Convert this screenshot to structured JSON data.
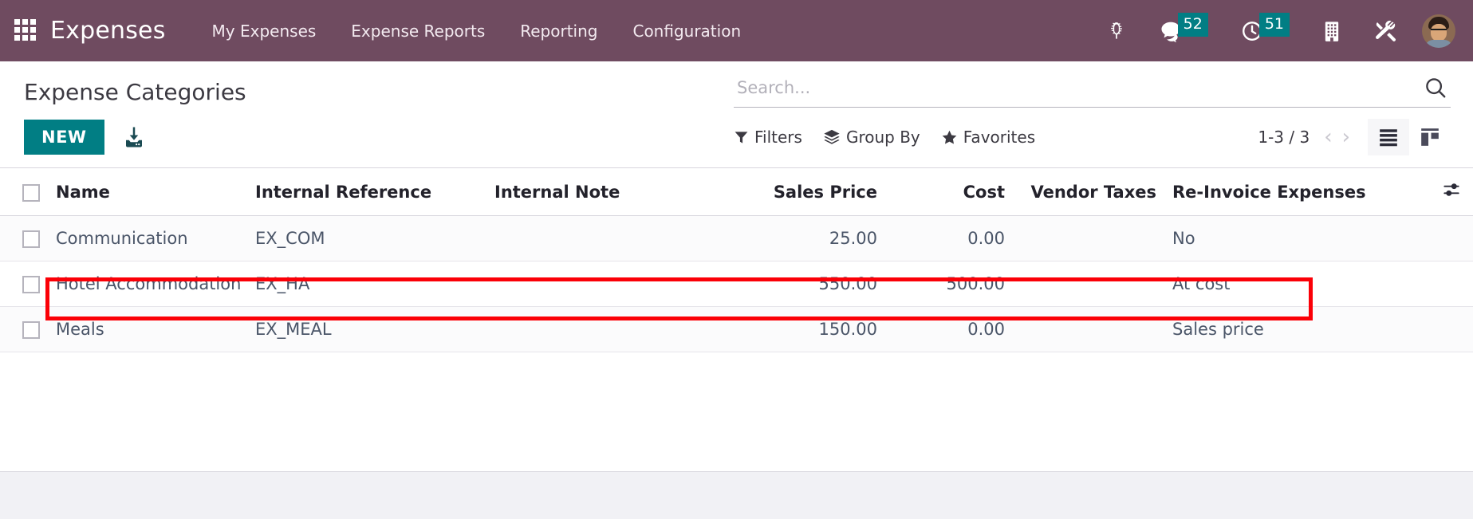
{
  "navbar": {
    "apps_icon": "apps-grid-icon",
    "brand": "Expenses",
    "menu": [
      {
        "label": "My Expenses",
        "icon": ""
      },
      {
        "label": "Expense Reports",
        "icon": ""
      },
      {
        "label": "Reporting",
        "icon": ""
      },
      {
        "label": "Configuration",
        "icon": ""
      }
    ],
    "systray": [
      {
        "name": "bug-icon",
        "badge": ""
      },
      {
        "name": "chat-bubble-icon",
        "badge": "52"
      },
      {
        "name": "clock-icon",
        "badge": "51"
      },
      {
        "name": "building-icon",
        "badge": ""
      },
      {
        "name": "tools-icon",
        "badge": ""
      }
    ],
    "avatar_label": "user-avatar",
    "bg_color": "#6f4b60",
    "badge_color": "#017e84"
  },
  "control_panel": {
    "title": "Expense Categories",
    "new_button": "NEW",
    "import_icon": "import-download-icon",
    "new_button_color": "#017e84",
    "search": {
      "placeholder": "Search...",
      "value": "",
      "icon": "search-icon"
    },
    "filters": [
      {
        "label": "Filters",
        "icon": "funnel-icon"
      },
      {
        "label": "Group By",
        "icon": "layers-icon"
      },
      {
        "label": "Favorites",
        "icon": "star-icon"
      }
    ],
    "pager": {
      "range": "1-3 / 3",
      "prev_icon": "chevron-left-icon",
      "next_icon": "chevron-right-icon"
    },
    "views": [
      {
        "name": "list-view-toggle",
        "icon": "list-icon",
        "active": true
      },
      {
        "name": "kanban-view-toggle",
        "icon": "kanban-icon",
        "active": false
      }
    ]
  },
  "table": {
    "columns": [
      {
        "key": "name",
        "label": "Name",
        "align": "left"
      },
      {
        "key": "internal_reference",
        "label": "Internal Reference",
        "align": "left"
      },
      {
        "key": "internal_note",
        "label": "Internal Note",
        "align": "left"
      },
      {
        "key": "sales_price",
        "label": "Sales Price",
        "align": "right"
      },
      {
        "key": "cost",
        "label": "Cost",
        "align": "right"
      },
      {
        "key": "vendor_taxes",
        "label": "Vendor Taxes",
        "align": "right"
      },
      {
        "key": "reinvoice_expenses",
        "label": "Re-Invoice Expenses",
        "align": "left"
      }
    ],
    "options_icon": "column-options-icon",
    "rows": [
      {
        "name": "Communication",
        "internal_reference": "EX_COM",
        "internal_note": "",
        "sales_price": "25.00",
        "cost": "0.00",
        "vendor_taxes": "",
        "reinvoice_expenses": "No",
        "highlighted": false
      },
      {
        "name": "Hotel Accommodation",
        "internal_reference": "EX_HA",
        "internal_note": "",
        "sales_price": "550.00",
        "cost": "500.00",
        "vendor_taxes": "",
        "reinvoice_expenses": "At cost",
        "highlighted": true
      },
      {
        "name": "Meals",
        "internal_reference": "EX_MEAL",
        "internal_note": "",
        "sales_price": "150.00",
        "cost": "0.00",
        "vendor_taxes": "",
        "reinvoice_expenses": "Sales price",
        "highlighted": false
      }
    ]
  },
  "annotation": {
    "color": "#fb0007",
    "target_row": "Hotel Accommodation"
  }
}
